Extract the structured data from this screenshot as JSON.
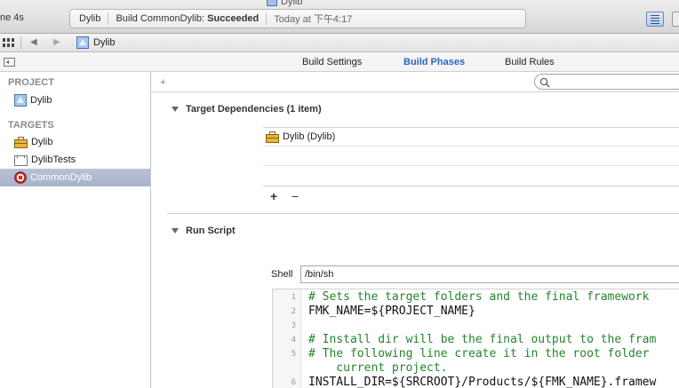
{
  "window": {
    "title": "Dylib",
    "scheme_fragment": "ne 4s",
    "activity": {
      "target": "Dylib",
      "status_prefix": "Build CommonDylib:",
      "status_result": "Succeeded",
      "time": "Today at 下午4:17"
    }
  },
  "jumpbar": {
    "item": "Dylib"
  },
  "tabs": {
    "build_settings": "Build Settings",
    "build_phases": "Build Phases",
    "build_rules": "Build Rules",
    "active": "Build Phases"
  },
  "sidebar": {
    "project_header": "PROJECT",
    "project_item": "Dylib",
    "targets_header": "TARGETS",
    "targets": [
      {
        "label": "Dylib",
        "icon": "toolbox-icon"
      },
      {
        "label": "DylibTests",
        "icon": "bundle-icon"
      },
      {
        "label": "CommonDylib",
        "icon": "target-icon",
        "selected": true
      }
    ]
  },
  "main": {
    "add_symbol": "+",
    "target_dependencies": {
      "title": "Target Dependencies (1 item)",
      "items": [
        "Dylib (Dylib)"
      ],
      "add": "+",
      "remove": "−"
    },
    "run_script": {
      "title": "Run Script",
      "shell_label": "Shell",
      "shell_value": "/bin/sh",
      "lines": [
        {
          "num": "1",
          "text": "# Sets the target folders and the final framework",
          "kind": "comment"
        },
        {
          "num": "2",
          "text": "FMK_NAME=${PROJECT_NAME}",
          "kind": "plain"
        },
        {
          "num": "3",
          "text": "",
          "kind": "plain"
        },
        {
          "num": "4",
          "text": "# Install dir will be the final output to the fram",
          "kind": "comment"
        },
        {
          "num": "5",
          "text": "# The following line create it in the root folder",
          "kind": "comment"
        },
        {
          "num": "",
          "text": "    current project.",
          "kind": "comment"
        },
        {
          "num": "6",
          "text": "INSTALL_DIR=${SRCROOT}/Products/${FMK_NAME}.framew",
          "kind": "plain"
        }
      ]
    }
  },
  "colors": {
    "accent": "#2b66c2",
    "comment": "#23852c",
    "selection": "#a8b2cb"
  }
}
